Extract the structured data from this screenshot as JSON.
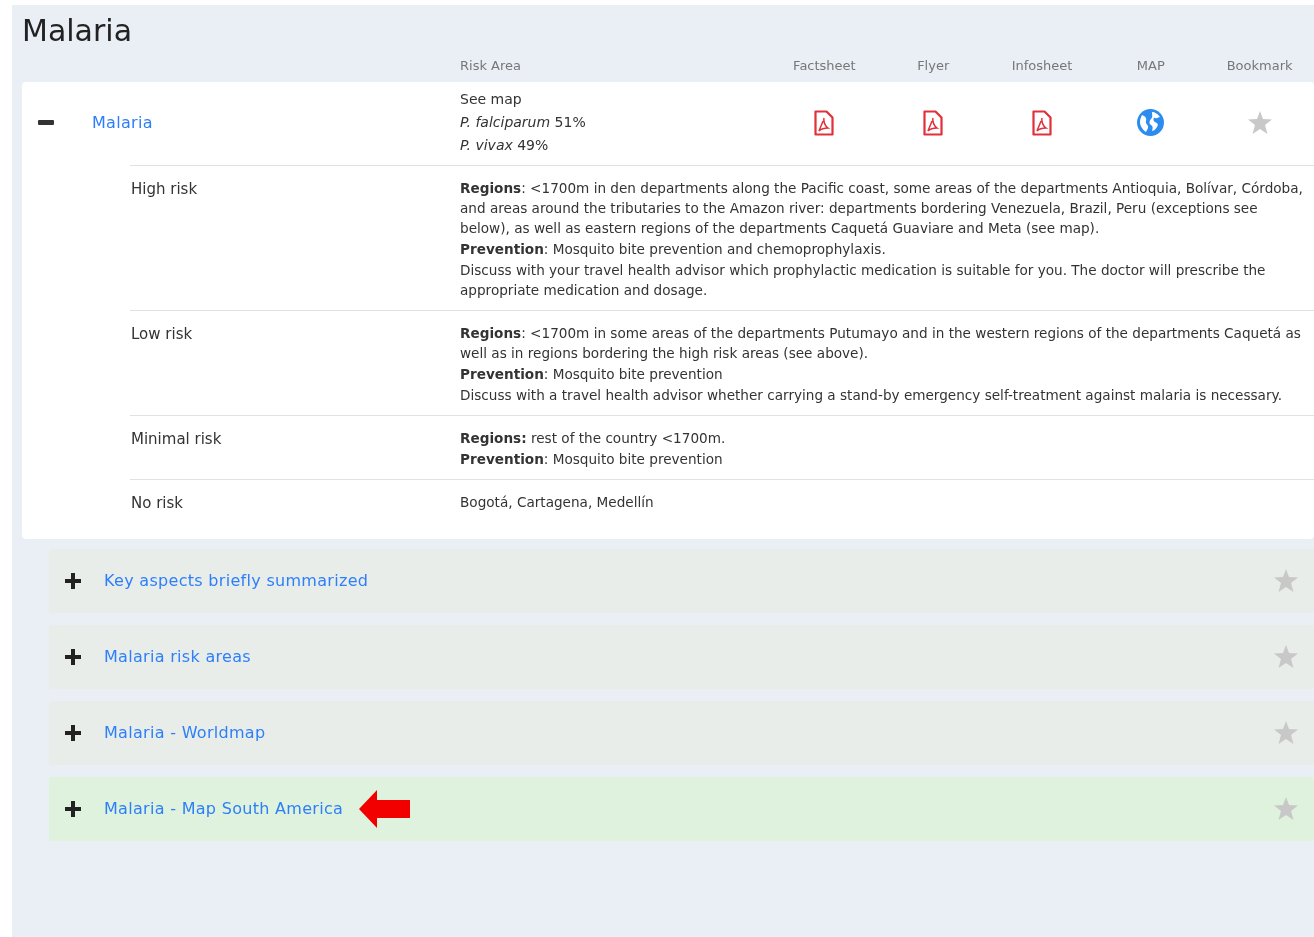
{
  "title": "Malaria",
  "columns": [
    "Risk Area",
    "Factsheet",
    "Flyer",
    "Infosheet",
    "MAP",
    "Bookmark"
  ],
  "main": {
    "label": "Malaria",
    "expanded": true,
    "bookmarked": false,
    "risk_area": [
      "See map",
      "*P. falciparum* 51%",
      "*P. vivax* 49%"
    ],
    "links": [
      {
        "kind": "pdf"
      },
      {
        "kind": "pdf"
      },
      {
        "kind": "pdf"
      },
      {
        "kind": "map"
      }
    ]
  },
  "risk_levels": [
    {
      "label": "High risk",
      "lines": [
        "**Regions**: <1700m in den departments along the Pacific coast, some areas of the departments  Antioquia, Bolívar, Córdoba, and areas around the tributaries to the Amazon river: departments bordering Venezuela, Brazil, Peru (exceptions see below), as well as eastern regions of the departments Caquetá Guaviare and Meta (see map).",
        "**Prevention**: Mosquito bite prevention and chemoprophylaxis.",
        "Discuss with your travel health advisor which prophylactic medication is suitable for you. The doctor will prescribe the appropriate medication and dosage."
      ]
    },
    {
      "label": "Low risk",
      "lines": [
        "**Regions**: <1700m in some areas of the departments Putumayo and in the western regions of the departments Caquetá as well as in regions bordering the high risk areas (see above).",
        "**Prevention**: Mosquito bite prevention",
        "Discuss with a travel health advisor whether carrying a stand-by emergency self-treatment against malaria is necessary."
      ]
    },
    {
      "label": "Minimal risk",
      "lines": [
        "**Regions:** rest of the country <1700m.",
        "**Prevention**: Mosquito bite prevention"
      ]
    },
    {
      "label": "No risk",
      "lines": [
        "Bogotá, Cartagena, Medellín"
      ]
    }
  ],
  "sections": [
    {
      "label": "Key aspects briefly summarized",
      "expanded": false,
      "selected": false,
      "bookmarked": false
    },
    {
      "label": "Malaria risk areas",
      "expanded": false,
      "selected": false,
      "bookmarked": false
    },
    {
      "label": "Malaria - Worldmap",
      "expanded": false,
      "selected": false,
      "bookmarked": false
    },
    {
      "label": "Malaria - Map South America",
      "expanded": false,
      "selected": true,
      "bookmarked": false
    }
  ]
}
